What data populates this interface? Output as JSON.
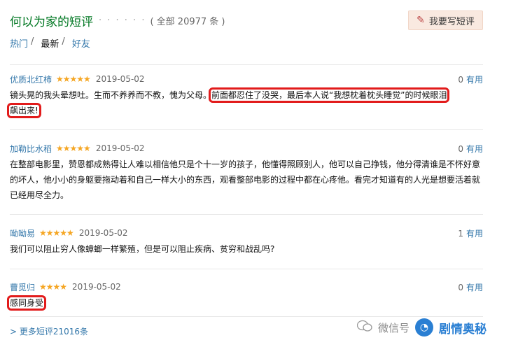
{
  "header": {
    "title": "何以为家的短评",
    "dots": "· · · · · ·",
    "count": "( 全部 20977 条 )"
  },
  "write_button": {
    "icon": "pencil-icon",
    "label": "我要写短评"
  },
  "tabs": [
    {
      "label": "热门",
      "sep": "/"
    },
    {
      "label": "最新",
      "sep": "/"
    },
    {
      "label": "好友",
      "sep": ""
    }
  ],
  "reviews": [
    {
      "user": "优质北红柿",
      "stars": "★★★★★",
      "rating": 5,
      "date": "2019-05-02",
      "useful_count": "0",
      "useful_label": "有用",
      "text_plain": "镜头晃的我头晕想吐。生而不养养而不教，愧为父母。",
      "text_highlight_a": "前面都忍住了没哭，最后本人说“我想枕着枕头睡觉”的时候眼泪",
      "text_highlight_b": "飙出来!"
    },
    {
      "user": "加勒比水稻",
      "stars": "★★★★★",
      "rating": 5,
      "date": "2019-05-02",
      "useful_count": "0",
      "useful_label": "有用",
      "text": "在整部电影里，赞恩都成熟得让人难以相信他只是个十一岁的孩子，他懂得照顾别人，他可以自己挣钱，他分得清谁是不怀好意的坏人，他小小的身躯要拖动着和自己一样大小的东西，观看整部电影的过程中都在心疼他。看完才知道有的人光是想要活着就已经用尽全力。"
    },
    {
      "user": "呦呦易",
      "stars": "★★★★★",
      "rating": 5,
      "date": "2019-05-02",
      "useful_count": "1",
      "useful_label": "有用",
      "text": "我们可以阻止穷人像蟑螂一样繁殖，但是可以阻止疾病、贫穷和战乱吗?"
    },
    {
      "user": "曹觅归",
      "stars": "★★★★",
      "rating": 4,
      "date": "2019-05-02",
      "useful_count": "0",
      "useful_label": "有用",
      "text": "感同身受"
    }
  ],
  "more_link": "> 更多短评21016条",
  "watermark": {
    "label": "微信号",
    "brand": "剧情奥秘"
  },
  "colors": {
    "accent_green": "#007722",
    "link_blue": "#3377aa",
    "highlight_red": "#e21b1b",
    "star": "#f5a623"
  }
}
